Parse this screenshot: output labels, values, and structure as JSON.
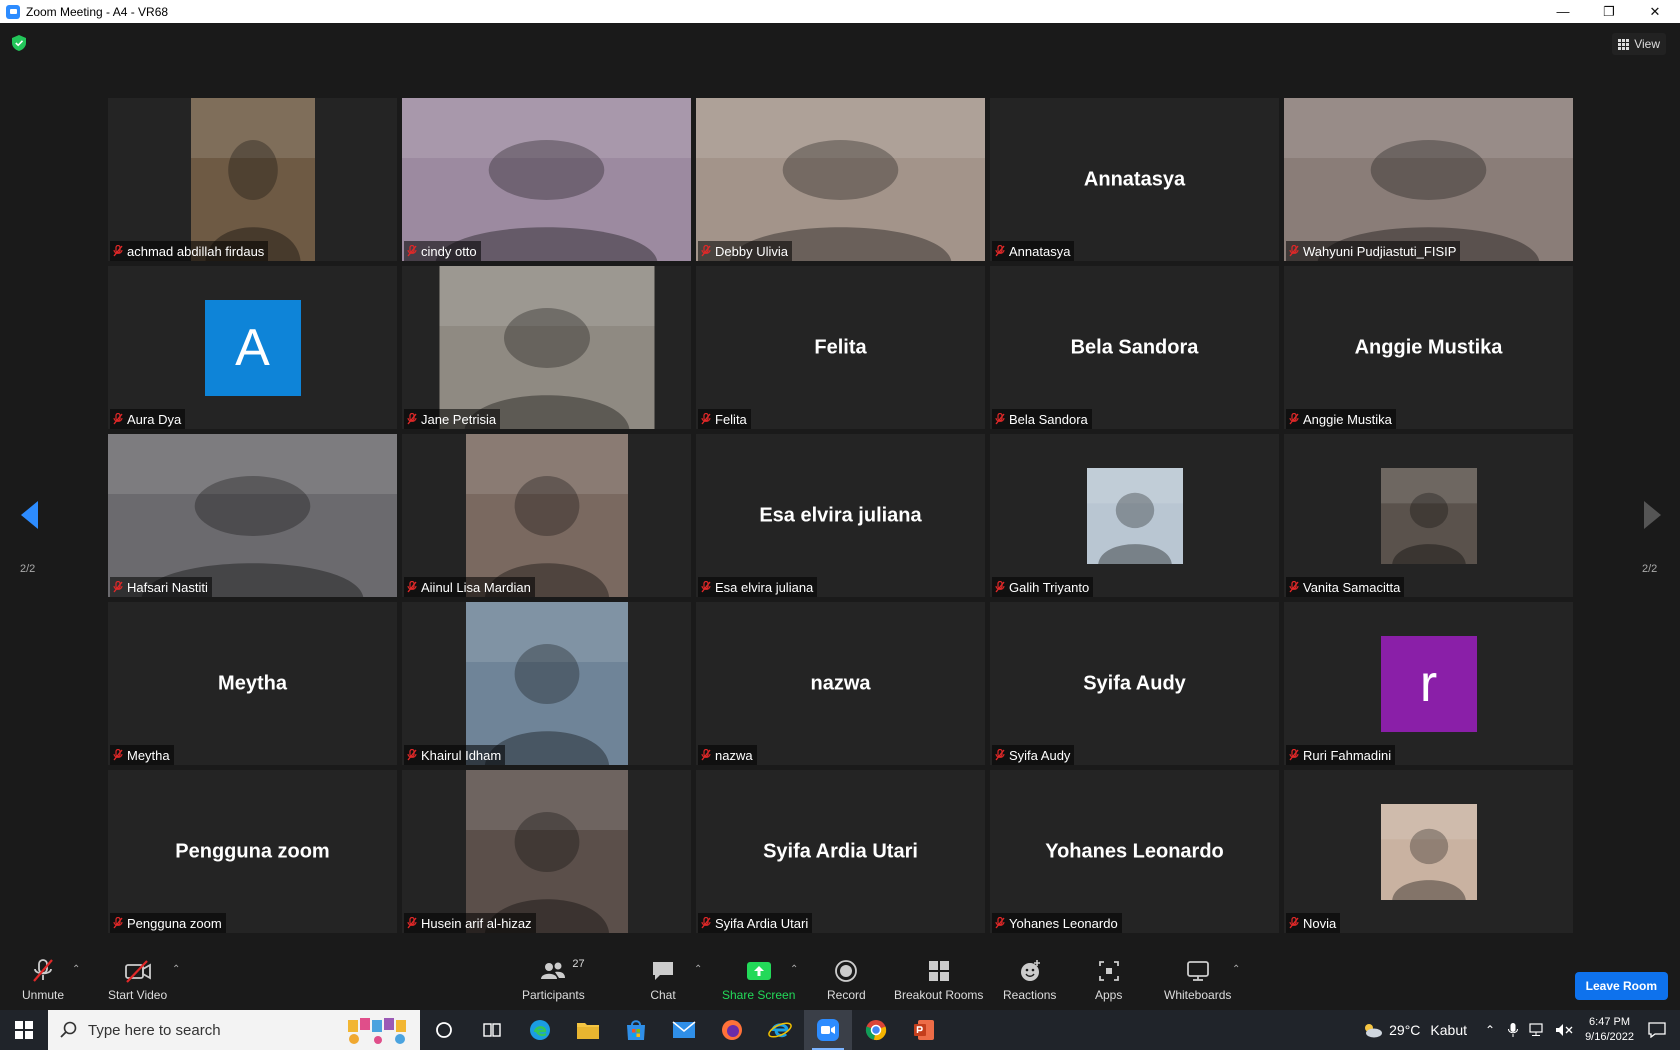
{
  "window": {
    "title": "Zoom Meeting - A4 - VR68",
    "minimize": "—",
    "restore": "❐",
    "close": "✕"
  },
  "meeting": {
    "view_label": "View",
    "page_left": "2/2",
    "page_right": "2/2"
  },
  "participants": [
    {
      "name": "achmad abdillah firdaus",
      "type": "video",
      "tone": "#6e5a44"
    },
    {
      "name": "cindy otto",
      "type": "video",
      "tone": "#9c8aa0"
    },
    {
      "name": "Debby Ulivia",
      "type": "video",
      "tone": "#a3948a"
    },
    {
      "name": "Annatasya",
      "display": "Annatasya",
      "type": "name"
    },
    {
      "name": "Wahyuni Pudjiastuti_FISIP",
      "type": "video",
      "tone": "#8a7d78",
      "active": true
    },
    {
      "name": "Aura Dya",
      "type": "avatar",
      "letter": "A",
      "color": "#0e84d8"
    },
    {
      "name": "Jane Petrisia",
      "type": "video",
      "tone": "#8f8a82"
    },
    {
      "name": "Felita",
      "display": "Felita",
      "type": "name"
    },
    {
      "name": "Bela Sandora",
      "display": "Bela Sandora",
      "type": "name"
    },
    {
      "name": "Anggie Mustika",
      "display": "Anggie Mustika",
      "type": "name"
    },
    {
      "name": "Hafsari Nastiti",
      "type": "video",
      "tone": "#6b6a6e"
    },
    {
      "name": "Aiinul Lisa Mardian",
      "type": "video",
      "tone": "#7a6960"
    },
    {
      "name": "Esa elvira juliana",
      "display": "Esa elvira juliana",
      "type": "name"
    },
    {
      "name": "Galih Triyanto",
      "type": "photo",
      "tone": "#b9c6d2"
    },
    {
      "name": "Vanita Samacitta",
      "type": "photo",
      "tone": "#5a524c"
    },
    {
      "name": "Meytha",
      "display": "Meytha",
      "type": "name"
    },
    {
      "name": "Khairul Idham",
      "type": "video",
      "tone": "#6f8498"
    },
    {
      "name": "nazwa",
      "display": "nazwa",
      "type": "name"
    },
    {
      "name": "Syifa Audy",
      "display": "Syifa Audy",
      "type": "name"
    },
    {
      "name": "Ruri Fahmadini",
      "type": "avatar",
      "letter": "r",
      "color": "#8a1fa8"
    },
    {
      "name": "Pengguna zoom",
      "display": "Pengguna zoom",
      "type": "name"
    },
    {
      "name": "Husein arif al-hizaz",
      "type": "video",
      "tone": "#5b4f4a"
    },
    {
      "name": "Syifa Ardia Utari",
      "display": "Syifa Ardia Utari",
      "type": "name"
    },
    {
      "name": "Yohanes Leonardo",
      "display": "Yohanes Leonardo",
      "type": "name"
    },
    {
      "name": "Novia",
      "type": "photo",
      "tone": "#c9b2a1"
    }
  ],
  "toolbar": {
    "unmute": "Unmute",
    "start_video": "Start Video",
    "participants": "Participants",
    "participants_count": "27",
    "chat": "Chat",
    "share_screen": "Share Screen",
    "record": "Record",
    "breakout_rooms": "Breakout Rooms",
    "reactions": "Reactions",
    "apps": "Apps",
    "whiteboards": "Whiteboards",
    "leave_room": "Leave Room"
  },
  "taskbar": {
    "search_placeholder": "Type here to search",
    "weather_temp": "29°C",
    "weather_text": "Kabut",
    "time": "6:47 PM",
    "date": "9/16/2022"
  },
  "colors": {
    "accent": "#2d8cff",
    "share_green": "#23d959",
    "mic_red": "#e02828",
    "active_speaker": "#e6f06a",
    "leave_blue": "#0e72ed"
  }
}
